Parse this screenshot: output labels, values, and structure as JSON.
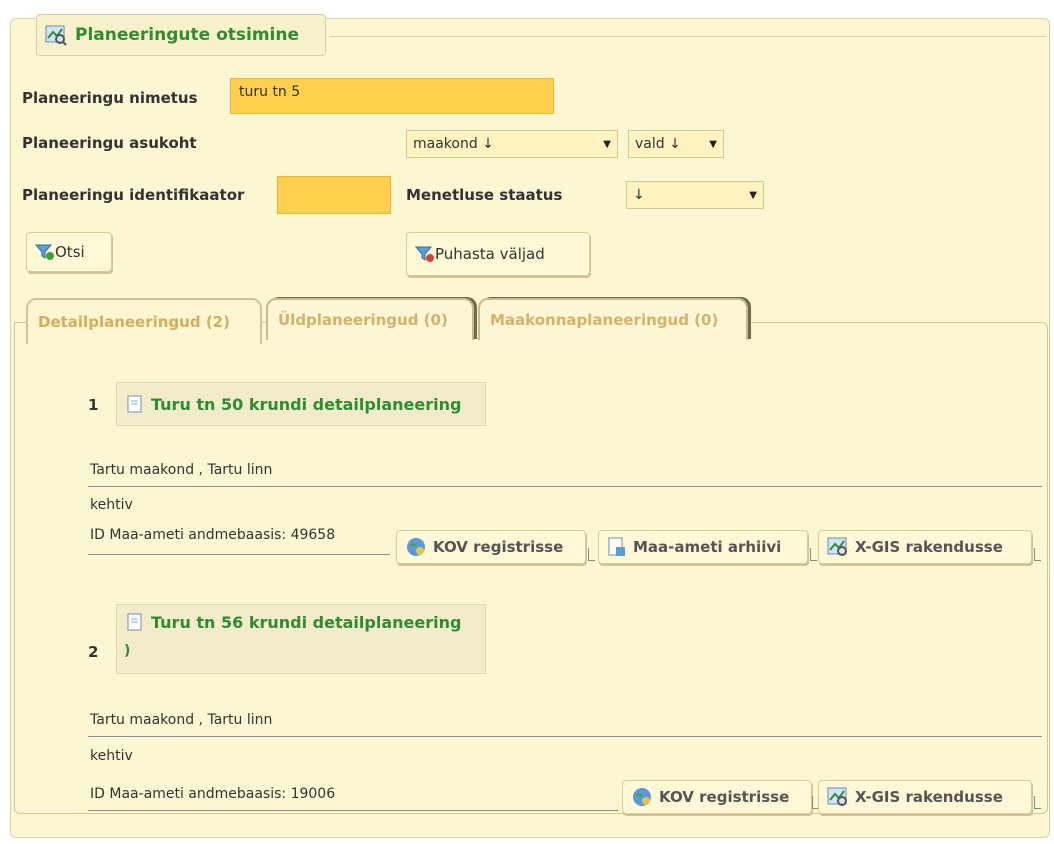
{
  "legend": {
    "title": "Planeeringute otsimine",
    "icon": "map-search-icon"
  },
  "form": {
    "name_label": "Planeeringu nimetus",
    "name_value": "turu tn 5",
    "location_label": "Planeeringu asukoht",
    "county_select": "maakond ↓",
    "parish_select": "vald ↓",
    "id_label": "Planeeringu identifikaator",
    "id_value": "",
    "status_label": "Menetluse staatus",
    "status_select": "↓",
    "search_button": "Otsi",
    "clear_button": "Puhasta väljad"
  },
  "tabs": [
    {
      "label": "Detailplaneeringud (2)",
      "active": true
    },
    {
      "label": "Üldplaneeringud (0)",
      "active": false
    },
    {
      "label": "Maakonnaplaneeringud (0)",
      "active": false
    }
  ],
  "results": [
    {
      "number": "1",
      "title": "Turu tn 50 krundi detailplaneering",
      "location": "Tartu maakond , Tartu linn",
      "status": "kehtiv",
      "id_text": "ID Maa-ameti andmebaasis: 49658",
      "buttons": [
        "KOV registrisse",
        "Maa-ameti arhiivi",
        "X-GIS rakendusse"
      ]
    },
    {
      "number": "2",
      "title": "Turu tn 56 krundi detailplaneering",
      "title_suffix": ")",
      "location": "Tartu maakond , Tartu linn",
      "status": "kehtiv",
      "id_text": "ID Maa-ameti andmebaasis: 19006",
      "buttons": [
        "KOV registrisse",
        "X-GIS rakendusse"
      ]
    }
  ],
  "colors": {
    "accent_green": "#2f8d2f",
    "input_orange": "#ffd04d",
    "panel_bg": "#fcf7d3"
  }
}
